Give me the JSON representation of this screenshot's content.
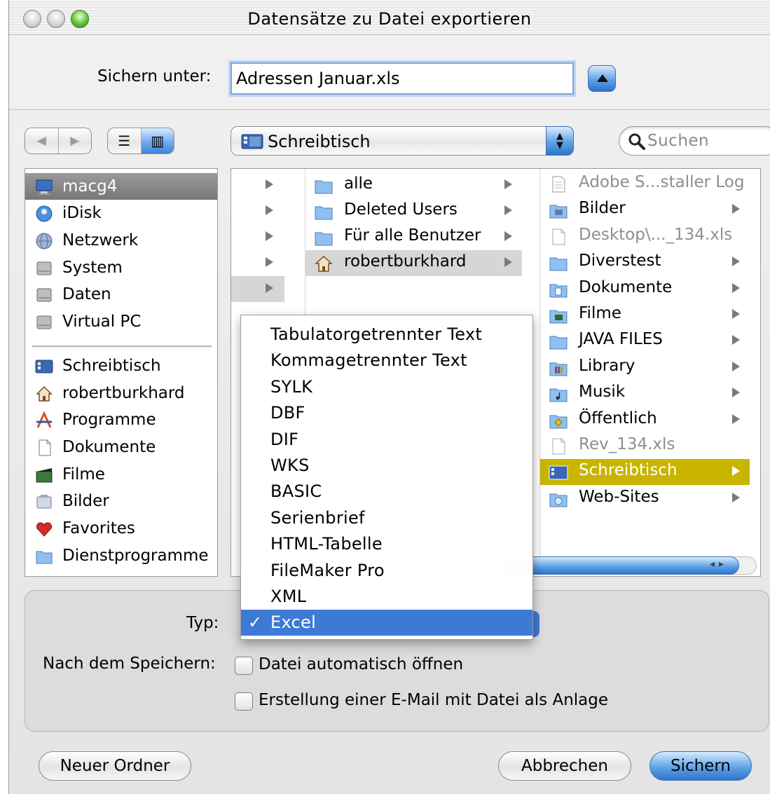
{
  "window": {
    "title": "Datensätze zu Datei exportieren"
  },
  "save": {
    "label": "Sichern unter:",
    "filename": "Adressen Januar.xls"
  },
  "nav": {
    "back_glyph": "◀",
    "forward_glyph": "▶",
    "list_view_glyph": "☰",
    "column_view_glyph": "▥",
    "location": "Schreibtisch",
    "search_placeholder": "Suchen"
  },
  "sidebar": {
    "devices": [
      {
        "label": "macg4",
        "icon": "computer-icon",
        "selected": true
      },
      {
        "label": "iDisk",
        "icon": "idisk-icon"
      },
      {
        "label": "Netzwerk",
        "icon": "network-icon"
      },
      {
        "label": "System",
        "icon": "harddisk-icon"
      },
      {
        "label": "Daten",
        "icon": "harddisk-icon"
      },
      {
        "label": "Virtual PC",
        "icon": "harddisk-icon"
      }
    ],
    "places": [
      {
        "label": "Schreibtisch",
        "icon": "desktop-icon"
      },
      {
        "label": "robertburkhard",
        "icon": "home-icon"
      },
      {
        "label": "Programme",
        "icon": "applications-icon"
      },
      {
        "label": "Dokumente",
        "icon": "documents-icon"
      },
      {
        "label": "Filme",
        "icon": "movies-icon"
      },
      {
        "label": "Bilder",
        "icon": "pictures-icon"
      },
      {
        "label": "Favorites",
        "icon": "heart-icon"
      },
      {
        "label": "Dienstprogramme",
        "icon": "folder-icon"
      }
    ]
  },
  "browser": {
    "column1": [
      {
        "label": "alle"
      },
      {
        "label": "Deleted Users"
      },
      {
        "label": "Für alle Benutzer"
      },
      {
        "label": "robertburkhard",
        "highlighted": true
      }
    ],
    "column2": [
      {
        "label": "Adobe S...staller Log",
        "dimmed": true,
        "icon": "log-file-icon"
      },
      {
        "label": "Bilder",
        "icon": "pictures-folder-icon"
      },
      {
        "label": "Desktop\\..._134.xls",
        "dimmed": true,
        "icon": "document-icon"
      },
      {
        "label": "Diverstest",
        "icon": "folder-icon"
      },
      {
        "label": "Dokumente",
        "icon": "documents-folder-icon"
      },
      {
        "label": "Filme",
        "icon": "movies-folder-icon"
      },
      {
        "label": "JAVA FILES",
        "icon": "folder-icon"
      },
      {
        "label": "Library",
        "icon": "library-folder-icon"
      },
      {
        "label": "Musik",
        "icon": "music-folder-icon"
      },
      {
        "label": "Öffentlich",
        "icon": "public-folder-icon"
      },
      {
        "label": "Rev_134.xls",
        "dimmed": true,
        "icon": "document-icon"
      },
      {
        "label": "Schreibtisch",
        "selected": true,
        "icon": "desktop-folder-icon"
      },
      {
        "label": "Web-Sites",
        "icon": "sites-folder-icon"
      }
    ]
  },
  "type_menu": {
    "label": "Typ:",
    "check_glyph": "✓",
    "items": [
      "Tabulatorgetrennter Text",
      "Kommagetrennter Text",
      "SYLK",
      "DBF",
      "DIF",
      "WKS",
      "BASIC",
      "Serienbrief",
      "HTML-Tabelle",
      "FileMaker Pro",
      "XML",
      "Excel"
    ],
    "selected": "Excel"
  },
  "after_save": {
    "label": "Nach dem Speichern:",
    "open_file": "Datei automatisch öffnen",
    "create_email": "Erstellung einer E-Mail mit Datei als Anlage"
  },
  "buttons": {
    "new_folder": "Neuer Ordner",
    "cancel": "Abbrechen",
    "save": "Sichern"
  },
  "colors": {
    "selection_blue": "#3d7ad6",
    "selection_gold": "#c9b500",
    "aqua_blue": "#5fa2e8"
  }
}
